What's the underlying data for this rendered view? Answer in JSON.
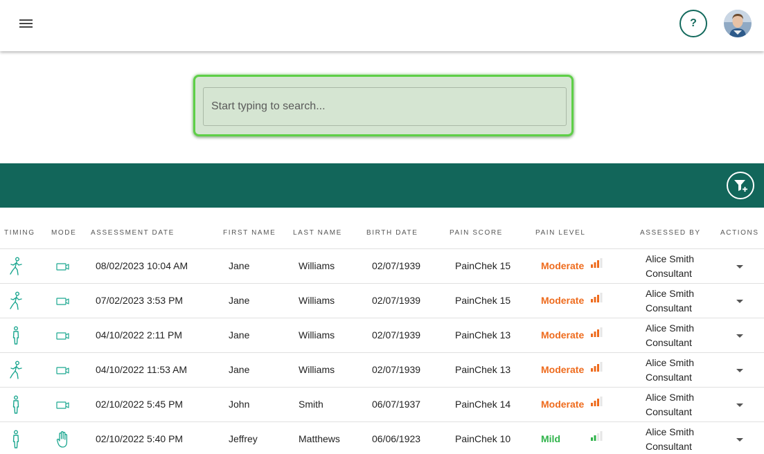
{
  "header": {
    "help_label": "?",
    "menu_icon": "menu-icon",
    "avatar_icon": "user-avatar"
  },
  "search": {
    "placeholder": "Start typing to search...",
    "value": ""
  },
  "colors": {
    "primary": "#12665a",
    "moderate": "#ee6b1d",
    "mild": "#2fb34a",
    "search_border": "#5ecf47"
  },
  "toolbar": {
    "filter_icon": "filter-add-icon"
  },
  "table": {
    "columns": [
      "TIMING",
      "MODE",
      "ASSESSMENT DATE",
      "FIRST NAME",
      "LAST NAME",
      "BIRTH DATE",
      "PAIN SCORE",
      "PAIN LEVEL",
      "ASSESSED BY",
      "ACTIONS"
    ],
    "rows": [
      {
        "timing": "movement",
        "mode": "video",
        "date": "08/02/2023 10:04 AM",
        "first": "Jane",
        "last": "Williams",
        "birth": "02/07/1939",
        "score": "PainChek 15",
        "level": "Moderate",
        "level_bars": 3,
        "assessor_name": "Alice Smith",
        "assessor_role": "Consultant"
      },
      {
        "timing": "movement",
        "mode": "video",
        "date": "07/02/2023 3:53 PM",
        "first": "Jane",
        "last": "Williams",
        "birth": "02/07/1939",
        "score": "PainChek 15",
        "level": "Moderate",
        "level_bars": 3,
        "assessor_name": "Alice Smith",
        "assessor_role": "Consultant"
      },
      {
        "timing": "rest",
        "mode": "video",
        "date": "04/10/2022 2:11 PM",
        "first": "Jane",
        "last": "Williams",
        "birth": "02/07/1939",
        "score": "PainChek 13",
        "level": "Moderate",
        "level_bars": 3,
        "assessor_name": "Alice Smith",
        "assessor_role": "Consultant"
      },
      {
        "timing": "movement",
        "mode": "video",
        "date": "04/10/2022 11:53 AM",
        "first": "Jane",
        "last": "Williams",
        "birth": "02/07/1939",
        "score": "PainChek 13",
        "level": "Moderate",
        "level_bars": 3,
        "assessor_name": "Alice Smith",
        "assessor_role": "Consultant"
      },
      {
        "timing": "rest",
        "mode": "video",
        "date": "02/10/2022 5:45 PM",
        "first": "John",
        "last": "Smith",
        "birth": "06/07/1937",
        "score": "PainChek 14",
        "level": "Moderate",
        "level_bars": 3,
        "assessor_name": "Alice Smith",
        "assessor_role": "Consultant"
      },
      {
        "timing": "rest",
        "mode": "manual",
        "date": "02/10/2022 5:40 PM",
        "first": "Jeffrey",
        "last": "Matthews",
        "birth": "06/06/1923",
        "score": "PainChek 10",
        "level": "Mild",
        "level_bars": 2,
        "assessor_name": "Alice Smith",
        "assessor_role": "Consultant"
      }
    ]
  }
}
